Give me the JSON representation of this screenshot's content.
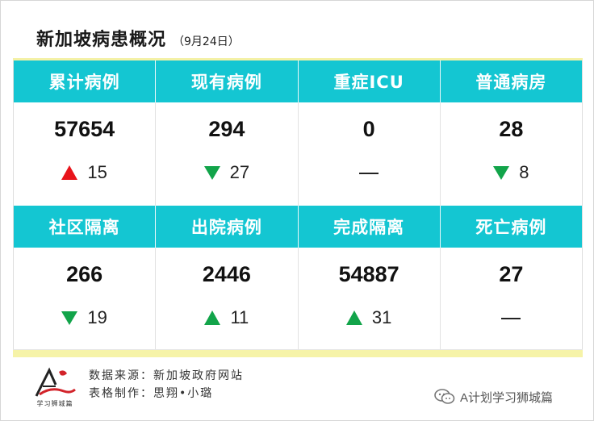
{
  "title": "新加坡病患概况",
  "date": "（9月24日）",
  "row1": {
    "headers": [
      "累计病例",
      "现有病例",
      "重症ICU",
      "普通病房"
    ],
    "cells": [
      {
        "value": "57654",
        "change": "15",
        "trend": "up-red"
      },
      {
        "value": "294",
        "change": "27",
        "trend": "down-green"
      },
      {
        "value": "0",
        "change": "",
        "trend": "none"
      },
      {
        "value": "28",
        "change": "8",
        "trend": "down-green"
      }
    ]
  },
  "row2": {
    "headers": [
      "社区隔离",
      "出院病例",
      "完成隔离",
      "死亡病例"
    ],
    "cells": [
      {
        "value": "266",
        "change": "19",
        "trend": "down-green"
      },
      {
        "value": "2446",
        "change": "11",
        "trend": "up-green"
      },
      {
        "value": "54887",
        "change": "31",
        "trend": "up-green"
      },
      {
        "value": "27",
        "change": "",
        "trend": "none"
      }
    ]
  },
  "footer": {
    "source_line": "数据来源：新加坡政府网站",
    "credit_line": "表格制作：思翔•小璐",
    "logo_text": "学习狮城篇",
    "wechat_account": "A计划学习狮城篇"
  },
  "colors": {
    "header_bg": "#14c6d2",
    "up_red": "#e8141b",
    "green": "#12a44a",
    "band_yellow": "#f6f3a8"
  }
}
